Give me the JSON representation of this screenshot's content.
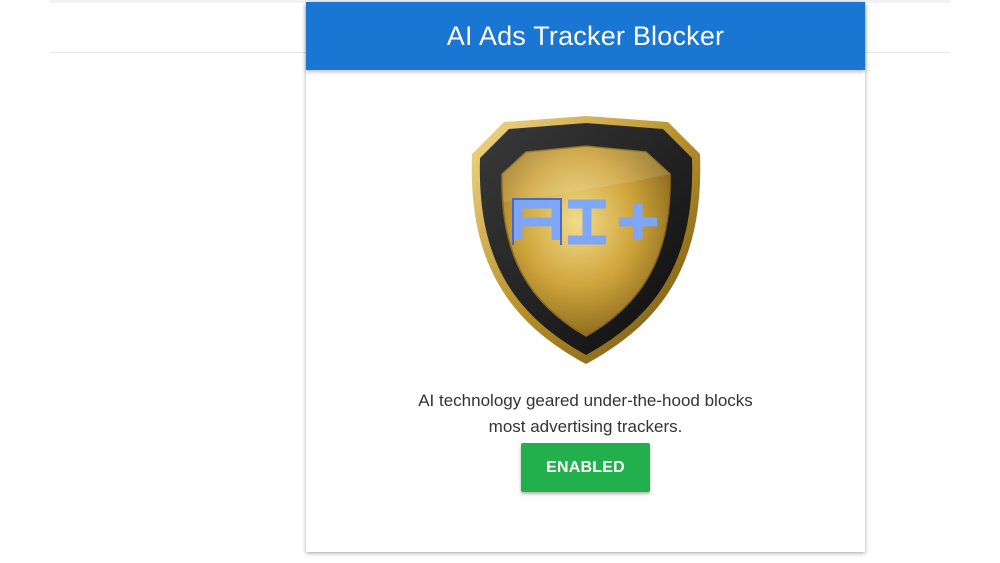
{
  "popup": {
    "title": "AI Ads Tracker Blocker",
    "logo": {
      "icon": "shield-icon",
      "text": "AI+"
    },
    "description_line1": "AI technology geared under-the-hood blocks",
    "description_line2": "most advertising trackers.",
    "status_button_label": "ENABLED"
  },
  "colors": {
    "header_background": "#1976d2",
    "button_background": "#21b04b",
    "shield_gold": "#c8a23a",
    "shield_border": "#1a1a1a",
    "logo_text": "#6f9bf0"
  }
}
